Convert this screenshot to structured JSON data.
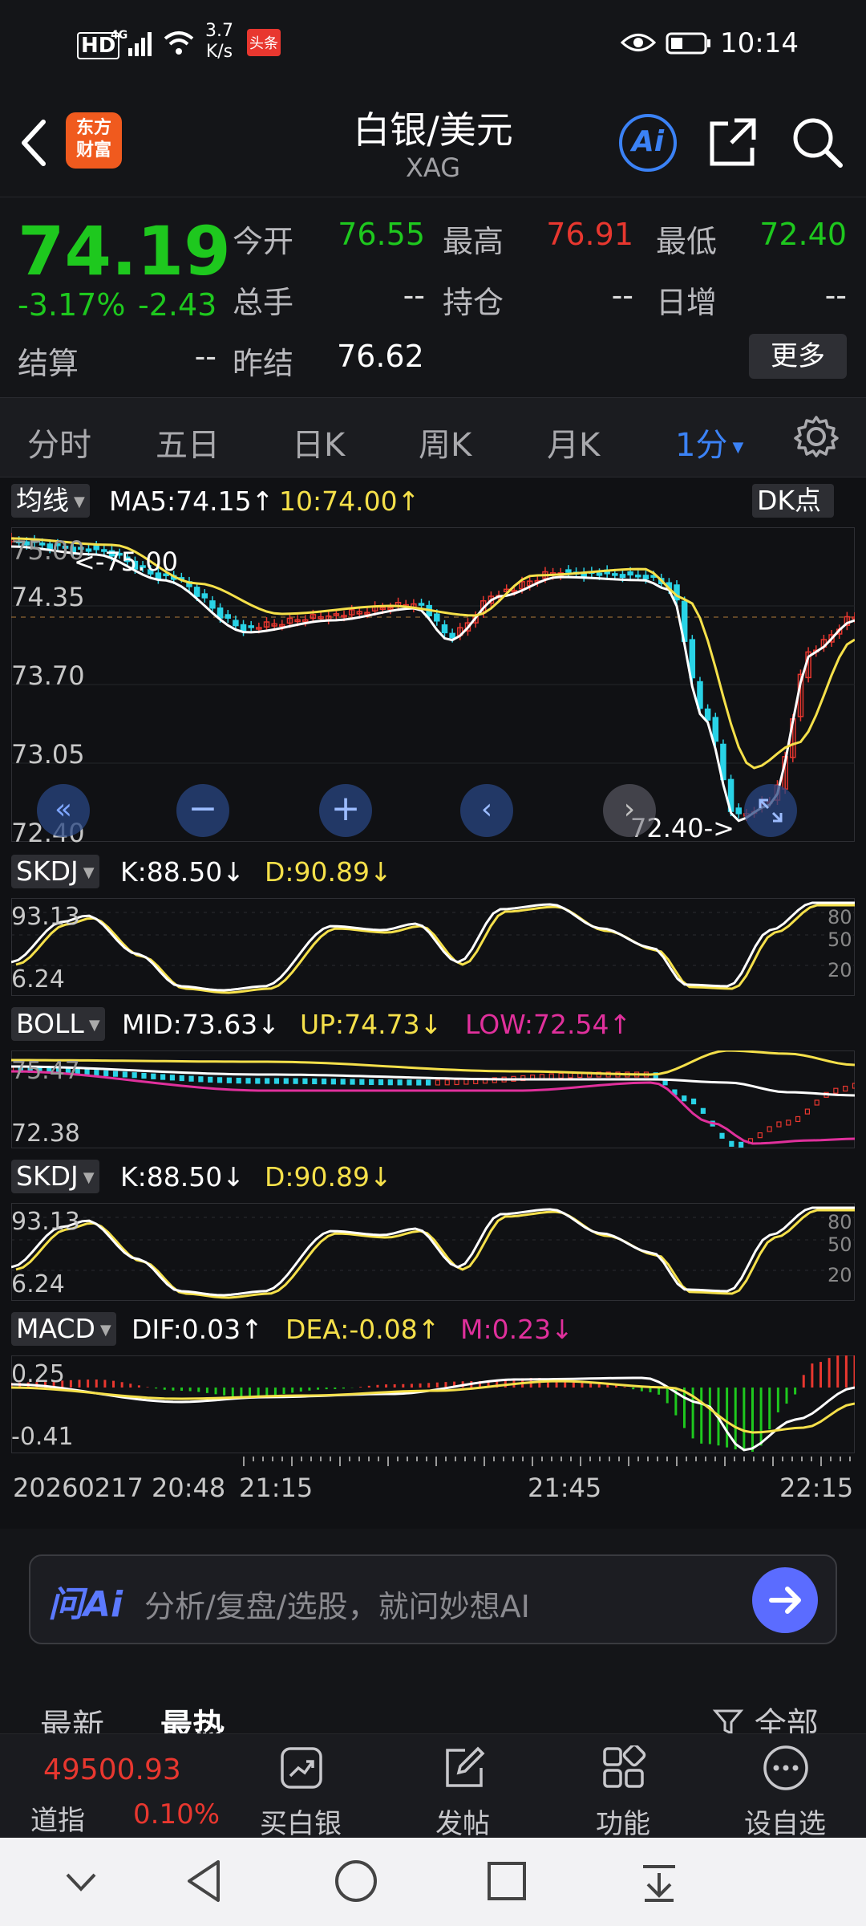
{
  "status_bar": {
    "hd": "HD",
    "signal": "4G",
    "net_speed": "3.7\nK/s",
    "speed_top": "3.7",
    "speed_bottom": "K/s",
    "notif_badge": "头条",
    "time": "10:14"
  },
  "header": {
    "logo_line1": "东方",
    "logo_line2": "财富",
    "title": "白银/美元",
    "symbol": "XAG",
    "ai_label": "Ai"
  },
  "quote": {
    "price": "74.19",
    "change_pct": "-3.17%",
    "change": "-2.43",
    "open_label": "今开",
    "open": "76.55",
    "high_label": "最高",
    "high": "76.91",
    "low_label": "最低",
    "low": "72.40",
    "volume_label": "总手",
    "volume": "--",
    "oi_label": "持仓",
    "oi": "--",
    "daily_inc_label": "日增",
    "daily_inc": "--",
    "settle_label": "结算",
    "settle": "--",
    "prev_settle_label": "昨结",
    "prev_settle": "76.62",
    "more_label": "更多"
  },
  "period_tabs": [
    "分时",
    "五日",
    "日K",
    "周K",
    "月K",
    "1分"
  ],
  "active_period": "1分",
  "main_chart": {
    "indicator_btn": "均线",
    "ma5": "MA5:74.15",
    "ma5_arrow": "↑",
    "ma10": "10:74.00",
    "ma10_arrow": "↑",
    "dk_btn": "DK点",
    "y_labels": [
      "75.00",
      "74.35",
      "73.70",
      "73.05",
      "72.40"
    ],
    "max_marker": "<-75.00",
    "min_marker": "72.40->"
  },
  "skdj1": {
    "btn": "SKDJ",
    "k": "K:88.50",
    "k_arrow": "↓",
    "d": "D:90.89",
    "d_arrow": "↓",
    "y_top": "93.13",
    "y_bottom": "6.24",
    "levels": [
      "80",
      "50",
      "20"
    ]
  },
  "boll": {
    "btn": "BOLL",
    "mid": "MID:73.63",
    "mid_arrow": "↓",
    "up": "UP:74.73",
    "up_arrow": "↓",
    "low": "LOW:72.54",
    "low_arrow": "↑",
    "y_top": "75.47",
    "y_bottom": "72.38"
  },
  "skdj2": {
    "btn": "SKDJ",
    "k": "K:88.50",
    "k_arrow": "↓",
    "d": "D:90.89",
    "d_arrow": "↓",
    "y_top": "93.13",
    "y_bottom": "6.24",
    "levels": [
      "80",
      "50",
      "20"
    ]
  },
  "macd": {
    "btn": "MACD",
    "dif": "DIF:0.03",
    "dif_arrow": "↑",
    "dea": "DEA:-0.08",
    "dea_arrow": "↑",
    "m": "M:0.23",
    "m_arrow": "↓",
    "y_top": "0.25",
    "y_bottom": "-0.41"
  },
  "time_axis": [
    "20260217 20:48",
    "21:15",
    "21:45",
    "22:15"
  ],
  "ai_bar": {
    "logo": "问Ai",
    "placeholder": "分析/复盘/选股，就问妙想AI"
  },
  "feed_tabs": {
    "latest": "最新",
    "hot": "最热",
    "filter": "全部"
  },
  "bottom_nav": {
    "index_value": "49500.93",
    "index_name": "道指",
    "index_change": "0.10%",
    "items": [
      "买白银",
      "发帖",
      "功能",
      "设自选"
    ]
  },
  "colors": {
    "up": "#e8372f",
    "down": "#1ec81e",
    "yellow": "#f5e04a",
    "magenta": "#e0309c",
    "cyan": "#29d3e6",
    "accent": "#3b82f6"
  },
  "chart_data": [
    {
      "type": "candlestick",
      "title": "1分",
      "ylim": [
        72.4,
        75.0
      ],
      "x": [
        "20:48",
        "21:15",
        "21:45",
        "22:15"
      ],
      "series": [
        {
          "name": "MA5",
          "last": 74.15
        },
        {
          "name": "MA10",
          "last": 74.0
        }
      ]
    },
    {
      "type": "line",
      "title": "SKDJ",
      "ylim": [
        6.24,
        93.13
      ],
      "series": [
        {
          "name": "K",
          "last": 88.5
        },
        {
          "name": "D",
          "last": 90.89
        }
      ]
    },
    {
      "type": "line",
      "title": "BOLL",
      "ylim": [
        72.38,
        75.47
      ],
      "series": [
        {
          "name": "MID",
          "last": 73.63
        },
        {
          "name": "UP",
          "last": 74.73
        },
        {
          "name": "LOW",
          "last": 72.54
        }
      ]
    },
    {
      "type": "bar",
      "title": "MACD",
      "ylim": [
        -0.41,
        0.25
      ],
      "series": [
        {
          "name": "DIF",
          "last": 0.03
        },
        {
          "name": "DEA",
          "last": -0.08
        },
        {
          "name": "M",
          "last": 0.23
        }
      ]
    }
  ]
}
